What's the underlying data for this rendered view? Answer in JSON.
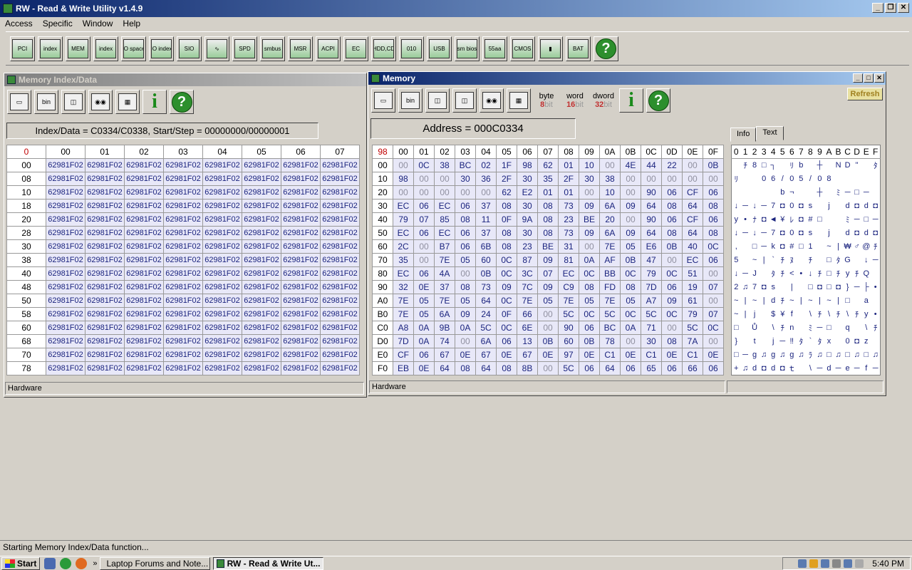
{
  "app": {
    "title": "RW - Read & Write Utility v1.4.9"
  },
  "menu": [
    "Access",
    "Specific",
    "Window",
    "Help"
  ],
  "toolbar": [
    {
      "name": "pci-icon",
      "glyph": "PCI"
    },
    {
      "name": "pci-index-icon",
      "glyph": "index"
    },
    {
      "name": "memory-icon",
      "glyph": "MEM"
    },
    {
      "name": "memory-index-icon",
      "glyph": "index"
    },
    {
      "name": "io-space-icon",
      "glyph": "IO space"
    },
    {
      "name": "io-index-icon",
      "glyph": "IO index"
    },
    {
      "name": "sio-icon",
      "glyph": "SIO"
    },
    {
      "name": "waveform-icon",
      "glyph": "∿"
    },
    {
      "name": "spd-icon",
      "glyph": "SPD"
    },
    {
      "name": "smbus-icon",
      "glyph": "smbus"
    },
    {
      "name": "msr-icon",
      "glyph": "MSR"
    },
    {
      "name": "acpi-icon",
      "glyph": "ACPI"
    },
    {
      "name": "ec-icon",
      "glyph": "EC"
    },
    {
      "name": "hdd-cd-icon",
      "glyph": "HDD,CD"
    },
    {
      "name": "disk-icon",
      "glyph": "010"
    },
    {
      "name": "usb-icon",
      "glyph": "USB"
    },
    {
      "name": "smbios-icon",
      "glyph": "sm bios"
    },
    {
      "name": "rom-icon",
      "glyph": "55aa"
    },
    {
      "name": "cmos-icon",
      "glyph": "CMOS"
    },
    {
      "name": "command-icon",
      "glyph": "▮"
    },
    {
      "name": "battery-icon",
      "glyph": "BAT"
    }
  ],
  "memIndex": {
    "title": "Memory Index/Data",
    "info": "Index/Data = C0334/C0338, Start/Step = 00000000/00000001",
    "corner": "0",
    "cols": [
      "00",
      "01",
      "02",
      "03",
      "04",
      "05",
      "06",
      "07"
    ],
    "rows": [
      "00",
      "08",
      "10",
      "18",
      "20",
      "28",
      "30",
      "38",
      "40",
      "48",
      "50",
      "58",
      "60",
      "68",
      "70",
      "78"
    ],
    "value": "62981F02",
    "status": "Hardware"
  },
  "memory": {
    "title": "Memory",
    "address": "Address = 000C0334",
    "refresh": "Refresh",
    "bitButtons": [
      {
        "top": "byte",
        "num": "8",
        "unit": "bit"
      },
      {
        "top": "word",
        "num": "16",
        "unit": "bit"
      },
      {
        "top": "dword",
        "num": "32",
        "unit": "bit"
      }
    ],
    "corner": "98",
    "cols": [
      "00",
      "01",
      "02",
      "03",
      "04",
      "05",
      "06",
      "07",
      "08",
      "09",
      "0A",
      "0B",
      "0C",
      "0D",
      "0E",
      "0F"
    ],
    "rows": [
      {
        "addr": "00",
        "vals": [
          "00",
          "0C",
          "38",
          "BC",
          "02",
          "1F",
          "98",
          "62",
          "01",
          "10",
          "00",
          "4E",
          "44",
          "22",
          "00",
          "0B"
        ]
      },
      {
        "addr": "10",
        "vals": [
          "98",
          "00",
          "00",
          "30",
          "36",
          "2F",
          "30",
          "35",
          "2F",
          "30",
          "38",
          "00",
          "00",
          "00",
          "00",
          "00"
        ]
      },
      {
        "addr": "20",
        "vals": [
          "00",
          "00",
          "00",
          "00",
          "00",
          "62",
          "E2",
          "01",
          "01",
          "00",
          "10",
          "00",
          "90",
          "06",
          "CF",
          "06"
        ]
      },
      {
        "addr": "30",
        "vals": [
          "EC",
          "06",
          "EC",
          "06",
          "37",
          "08",
          "30",
          "08",
          "73",
          "09",
          "6A",
          "09",
          "64",
          "08",
          "64",
          "08"
        ]
      },
      {
        "addr": "40",
        "vals": [
          "79",
          "07",
          "85",
          "08",
          "11",
          "0F",
          "9A",
          "08",
          "23",
          "BE",
          "20",
          "00",
          "90",
          "06",
          "CF",
          "06"
        ]
      },
      {
        "addr": "50",
        "vals": [
          "EC",
          "06",
          "EC",
          "06",
          "37",
          "08",
          "30",
          "08",
          "73",
          "09",
          "6A",
          "09",
          "64",
          "08",
          "64",
          "08"
        ]
      },
      {
        "addr": "60",
        "vals": [
          "2C",
          "00",
          "B7",
          "06",
          "6B",
          "08",
          "23",
          "BE",
          "31",
          "00",
          "7E",
          "05",
          "E6",
          "0B",
          "40",
          "0C"
        ]
      },
      {
        "addr": "70",
        "vals": [
          "35",
          "00",
          "7E",
          "05",
          "60",
          "0C",
          "87",
          "09",
          "81",
          "0A",
          "AF",
          "0B",
          "47",
          "00",
          "EC",
          "06"
        ]
      },
      {
        "addr": "80",
        "vals": [
          "EC",
          "06",
          "4A",
          "00",
          "0B",
          "0C",
          "3C",
          "07",
          "EC",
          "0C",
          "BB",
          "0C",
          "79",
          "0C",
          "51",
          "00"
        ]
      },
      {
        "addr": "90",
        "vals": [
          "32",
          "0E",
          "37",
          "08",
          "73",
          "09",
          "7C",
          "09",
          "C9",
          "08",
          "FD",
          "08",
          "7D",
          "06",
          "19",
          "07"
        ]
      },
      {
        "addr": "A0",
        "vals": [
          "7E",
          "05",
          "7E",
          "05",
          "64",
          "0C",
          "7E",
          "05",
          "7E",
          "05",
          "7E",
          "05",
          "A7",
          "09",
          "61",
          "00"
        ]
      },
      {
        "addr": "B0",
        "vals": [
          "7E",
          "05",
          "6A",
          "09",
          "24",
          "0F",
          "66",
          "00",
          "5C",
          "0C",
          "5C",
          "0C",
          "5C",
          "0C",
          "79",
          "07"
        ]
      },
      {
        "addr": "C0",
        "vals": [
          "A8",
          "0A",
          "9B",
          "0A",
          "5C",
          "0C",
          "6E",
          "00",
          "90",
          "06",
          "BC",
          "0A",
          "71",
          "00",
          "5C",
          "0C"
        ]
      },
      {
        "addr": "D0",
        "vals": [
          "7D",
          "0A",
          "74",
          "00",
          "6A",
          "06",
          "13",
          "0B",
          "60",
          "0B",
          "78",
          "00",
          "30",
          "08",
          "7A",
          "00"
        ]
      },
      {
        "addr": "E0",
        "vals": [
          "CF",
          "06",
          "67",
          "0E",
          "67",
          "0E",
          "67",
          "0E",
          "97",
          "0E",
          "C1",
          "0E",
          "C1",
          "0E",
          "C1",
          "0E"
        ]
      },
      {
        "addr": "F0",
        "vals": [
          "EB",
          "0E",
          "64",
          "08",
          "64",
          "08",
          "8B",
          "00",
          "5C",
          "06",
          "64",
          "06",
          "65",
          "06",
          "66",
          "06"
        ]
      }
    ],
    "tabs": [
      "Info",
      "Text"
    ],
    "textHeader": [
      "0",
      "1",
      "2",
      "3",
      "4",
      "5",
      "6",
      "7",
      "8",
      "9",
      "A",
      "B",
      "C",
      "D",
      "E",
      "F"
    ],
    "textRows": [
      [
        "",
        "ﾁ",
        "8",
        "□",
        "┐",
        "",
        "ﾘ",
        "b",
        "",
        "┼",
        "",
        "N",
        "D",
        "\"",
        "",
        "ﾀ"
      ],
      [
        "ﾘ",
        "",
        "",
        "0",
        "6",
        "/",
        "0",
        "5",
        "/",
        "0",
        "8",
        "",
        "",
        "",
        "",
        ""
      ],
      [
        "",
        "",
        "",
        "",
        "",
        "b",
        "¬",
        "",
        "",
        "┼",
        "",
        "ﾐ",
        "─",
        "□",
        "─",
        ""
      ],
      [
        "↓",
        "─",
        "↓",
        "─",
        "7",
        "◘",
        "0",
        "◘",
        "s",
        "",
        "j",
        "",
        "d",
        "◘",
        "d",
        "◘"
      ],
      [
        "y",
        "•",
        "ﾅ",
        "◘",
        "◄",
        "¥",
        "ﾚ",
        "◘",
        "#",
        "□",
        "",
        "",
        "ﾐ",
        "─",
        "□",
        "─"
      ],
      [
        "↓",
        "─",
        "↓",
        "─",
        "7",
        "◘",
        "0",
        "◘",
        "s",
        "",
        "j",
        "",
        "d",
        "◘",
        "d",
        "◘"
      ],
      [
        ",",
        "",
        "□",
        "─",
        "k",
        "◘",
        "#",
        "□",
        "1",
        "",
        "~",
        "|",
        "₩",
        "♂",
        "@",
        "ﾁ"
      ],
      [
        "5",
        "",
        "~",
        "|",
        "`",
        "ﾁ",
        "ﾇ",
        "",
        "ﾁ",
        "",
        "□",
        "ﾀ",
        "G",
        "",
        "↓",
        "─"
      ],
      [
        "↓",
        "─",
        "J",
        "",
        "ﾀ",
        "ﾁ",
        "<",
        "•",
        "↓",
        "ﾁ",
        "□",
        "ﾁ",
        "y",
        "ﾁ",
        "Q",
        ""
      ],
      [
        "2",
        "♫",
        "7",
        "◘",
        "s",
        "",
        "|",
        "",
        "□",
        "◘",
        "□",
        "◘",
        "}",
        "─",
        "├",
        "•"
      ],
      [
        "~",
        "|",
        "~",
        "|",
        "d",
        "ﾁ",
        "~",
        "|",
        "~",
        "|",
        "~",
        "|",
        "□",
        "",
        "a",
        ""
      ],
      [
        "~",
        "|",
        "j",
        "",
        "$",
        "¥",
        "f",
        "",
        "\\",
        "ﾁ",
        "\\",
        "ﾁ",
        "\\",
        "ﾁ",
        "y",
        "•"
      ],
      [
        "□",
        "",
        "Ů",
        "",
        "\\",
        "ﾁ",
        "n",
        "",
        "ﾐ",
        "─",
        "□",
        "",
        "q",
        "",
        "\\",
        "ﾁ"
      ],
      [
        "}",
        "",
        "t",
        "",
        "j",
        "─",
        "‼",
        "ﾀ",
        "`",
        "ﾀ",
        "x",
        "",
        "0",
        "◘",
        "z",
        ""
      ],
      [
        "□",
        "─",
        "g",
        "♫",
        "g",
        "♫",
        "g",
        "♫",
        "ﾗ",
        "♫",
        "□",
        "♫",
        "□",
        "♫",
        "□",
        "♫"
      ],
      [
        "+",
        "♫",
        "d",
        "◘",
        "d",
        "◘",
        "ｔ",
        "",
        "\\",
        "─",
        "d",
        "─",
        "e",
        "─",
        "f",
        "─"
      ]
    ],
    "status": "Hardware"
  },
  "statusbar": {
    "text": "Starting Memory Index/Data function..."
  },
  "taskbar": {
    "start": "Start",
    "items": [
      {
        "label": "Laptop Forums and Note..."
      },
      {
        "label": "RW - Read & Write Ut..."
      }
    ],
    "clock": "5:40 PM"
  },
  "colors": {
    "titlebar": "#0a246a",
    "cellValue": "#1a237e",
    "cellBg": "#e8e8f8",
    "corner": "#c00000"
  }
}
